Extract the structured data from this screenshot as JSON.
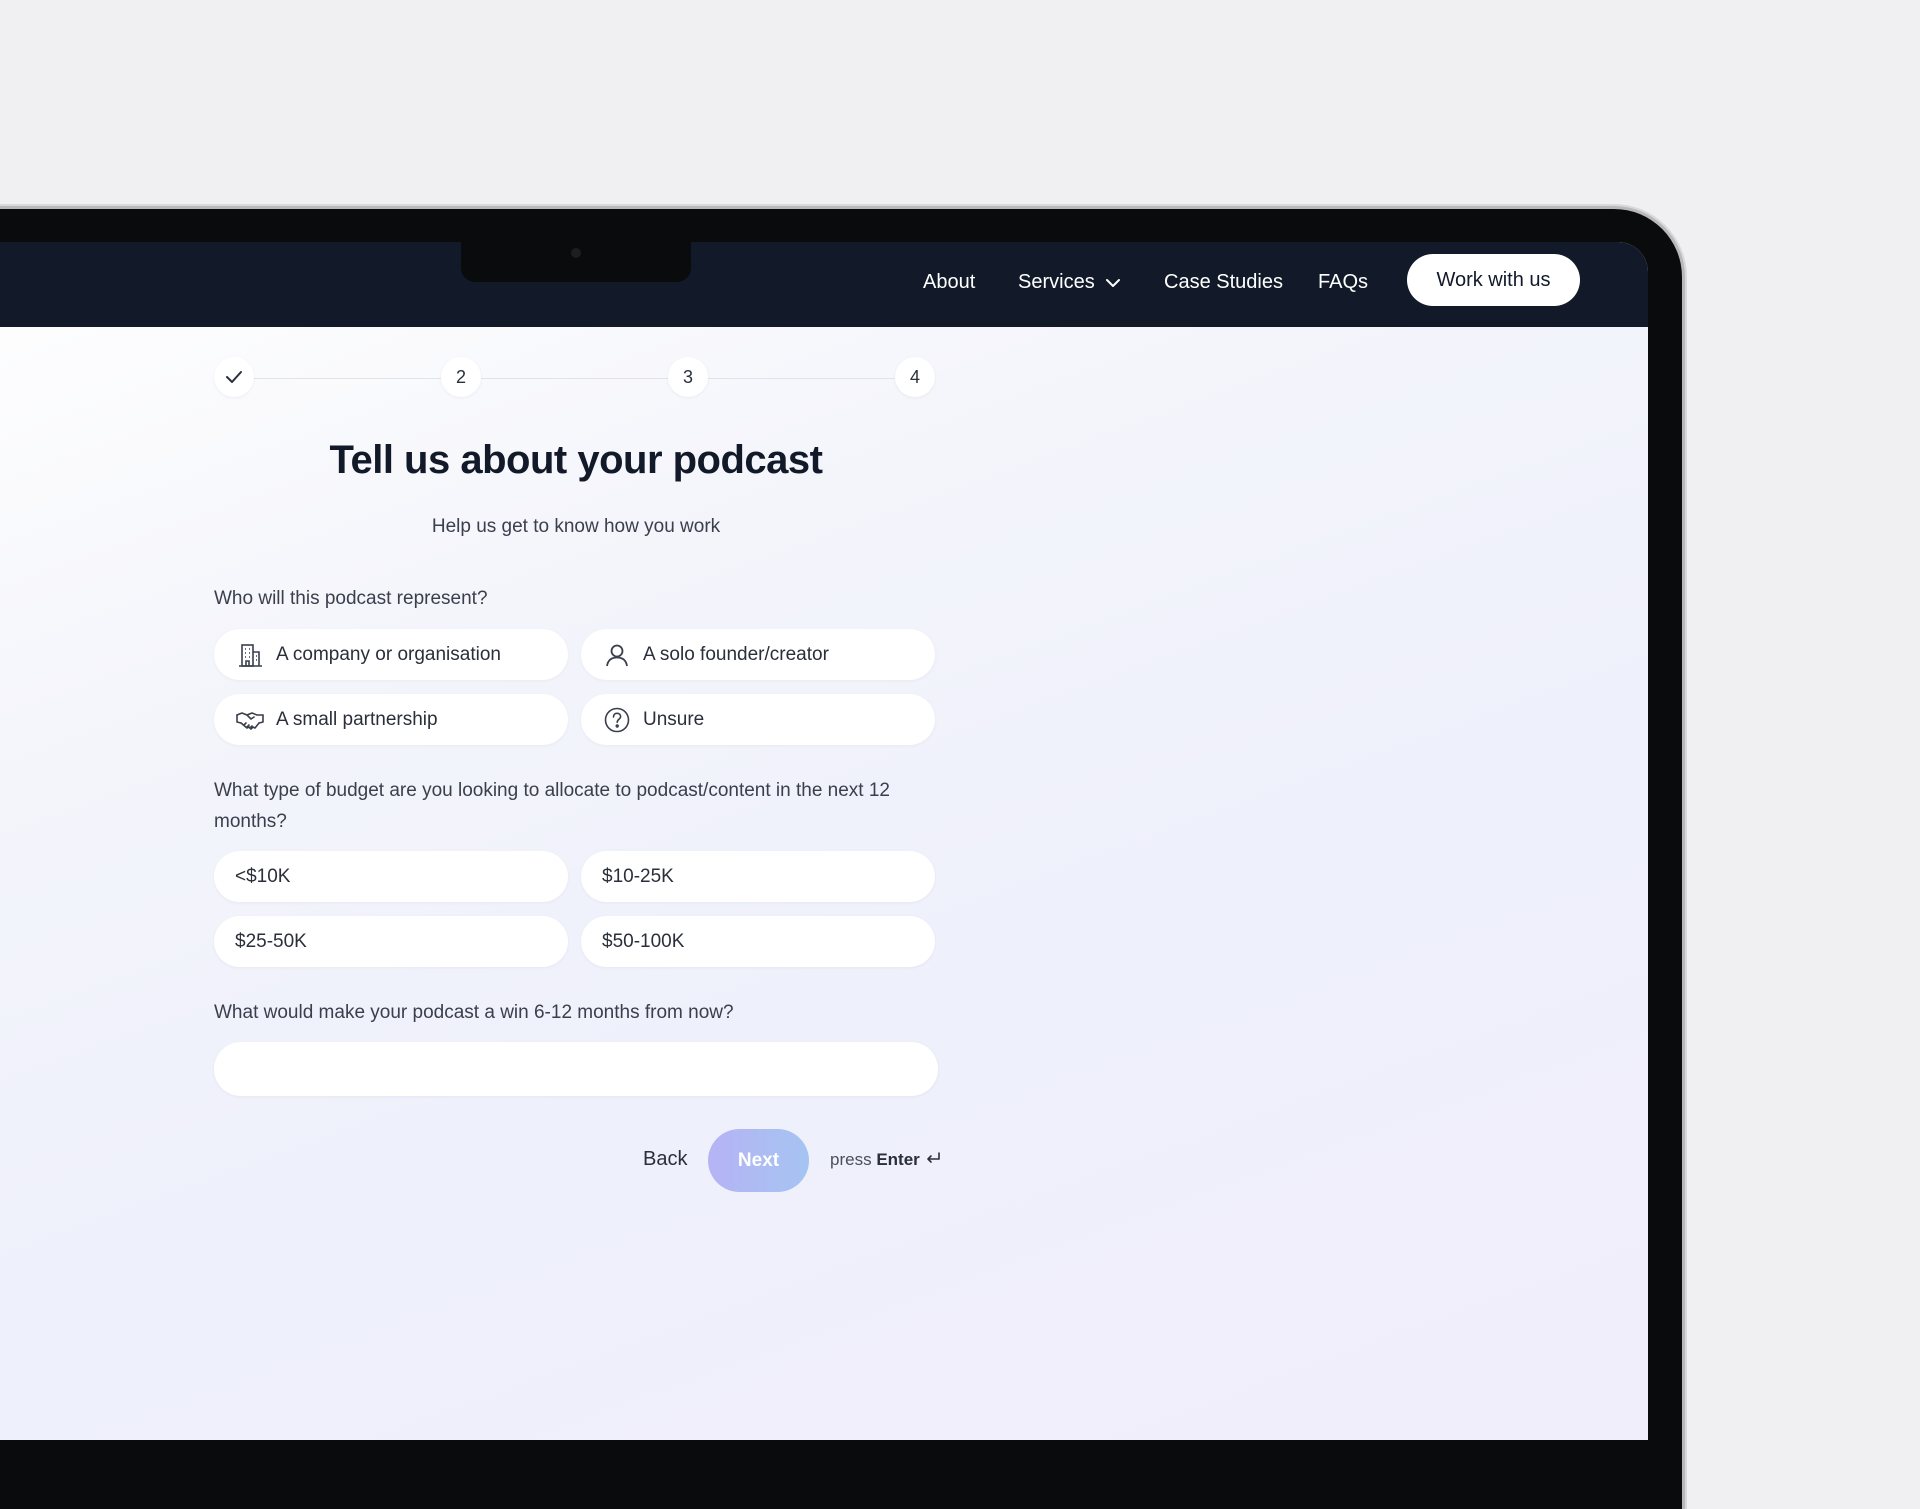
{
  "nav": {
    "links": [
      "About",
      "Services",
      "Case Studies",
      "FAQs"
    ],
    "cta": "Work with us"
  },
  "stepper": {
    "steps": [
      "",
      "2",
      "3",
      "4"
    ],
    "completed_step": 1
  },
  "form": {
    "title": "Tell us about your podcast",
    "subtitle": "Help us get to know how you work",
    "q1": {
      "label": "Who will this podcast represent?",
      "options": [
        {
          "label": "A company or organisation",
          "icon": "building-icon"
        },
        {
          "label": "A solo founder/creator",
          "icon": "person-icon"
        },
        {
          "label": "A small partnership",
          "icon": "handshake-icon"
        },
        {
          "label": "Unsure",
          "icon": "question-icon"
        }
      ]
    },
    "q2": {
      "label": "What type of budget are you looking to allocate to podcast/content in the next 12 months?",
      "options": [
        "<$10K",
        "$10-25K",
        "$25-50K",
        "$50-100K"
      ]
    },
    "q3": {
      "label": "What would make your podcast a win 6-12 months from now?",
      "value": "",
      "placeholder": ""
    },
    "actions": {
      "back": "Back",
      "next": "Next",
      "hint_prefix": "press",
      "hint_key": "Enter"
    }
  },
  "colors": {
    "nav_bg": "#121a2a",
    "next_gradient_start": "#b6b3f4",
    "next_gradient_end": "#a5c4f2"
  }
}
